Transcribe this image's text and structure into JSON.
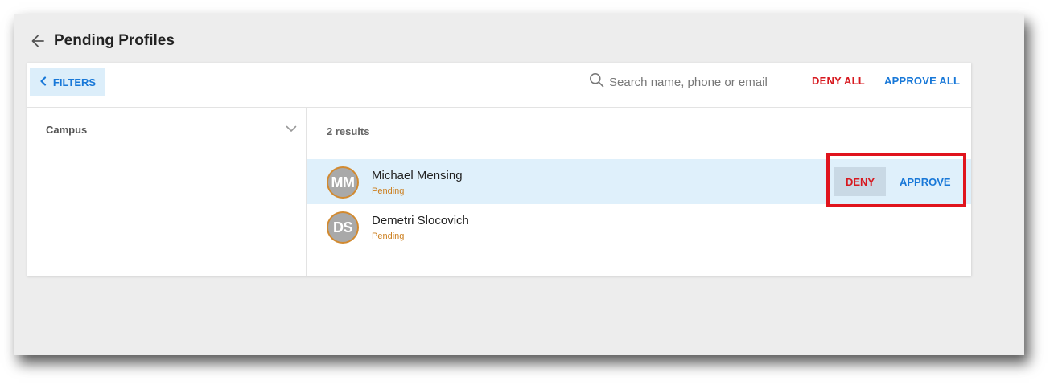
{
  "header": {
    "title": "Pending Profiles",
    "back_icon": "arrow-left-icon"
  },
  "toolbar": {
    "filters_label": "FILTERS",
    "filters_icon": "chevron-left-icon",
    "search": {
      "placeholder": "Search name, phone or email",
      "value": "",
      "icon": "search-icon"
    },
    "deny_all_label": "DENY ALL",
    "approve_all_label": "APPROVE ALL"
  },
  "sidebar": {
    "filters": [
      {
        "label": "Campus",
        "icon": "chevron-down-icon"
      }
    ]
  },
  "main": {
    "result_count": "2 results",
    "profiles": [
      {
        "initials": "MM",
        "name": "Michael Mensing",
        "status": "Pending",
        "selected": true,
        "deny_label": "DENY",
        "approve_label": "APPROVE"
      },
      {
        "initials": "DS",
        "name": "Demetri Slocovich",
        "status": "Pending",
        "selected": false
      }
    ]
  },
  "colors": {
    "accent_blue": "#1878d8",
    "deny_red": "#d7191f",
    "pending_orange": "#cc7f1f",
    "selected_row": "#dff0fb",
    "highlight_red": "#e0141d"
  }
}
